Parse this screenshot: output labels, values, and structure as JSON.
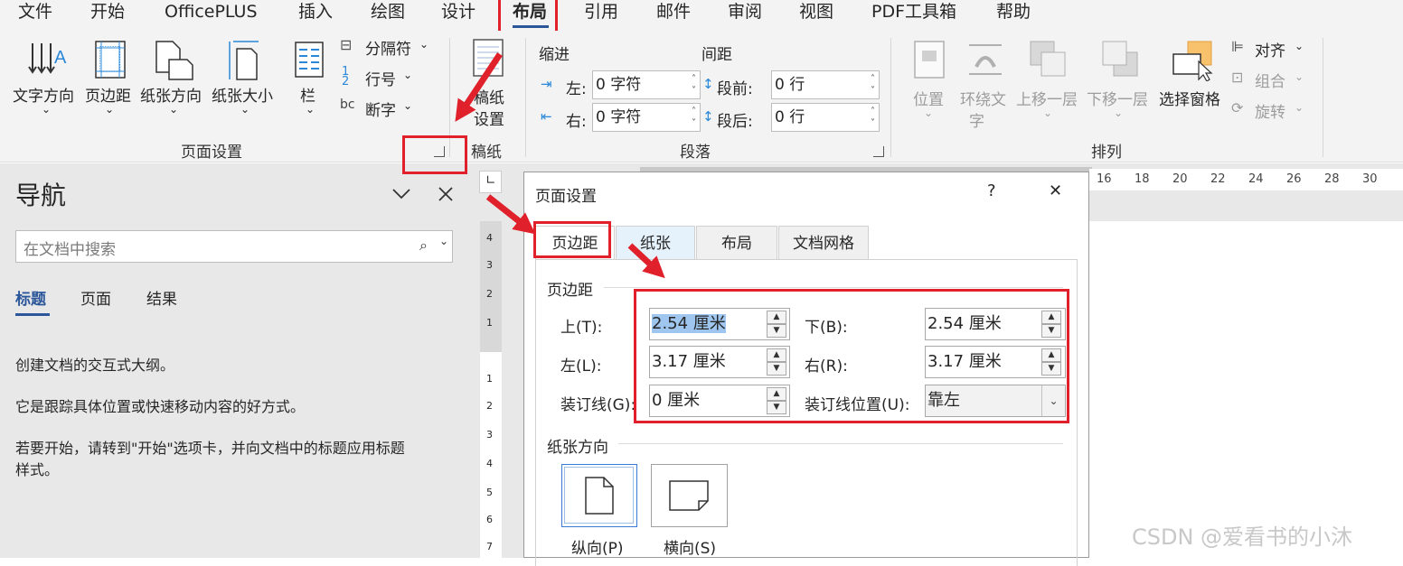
{
  "menubar": {
    "items": [
      "文件",
      "开始",
      "OfficePLUS",
      "插入",
      "绘图",
      "设计",
      "布局",
      "引用",
      "邮件",
      "审阅",
      "视图",
      "PDF工具箱",
      "帮助"
    ],
    "active": "布局"
  },
  "ribbon": {
    "page_setup": {
      "text_direction": "文字方向",
      "margins": "页边距",
      "orientation": "纸张方向",
      "size": "纸张大小",
      "columns": "栏",
      "breaks": "分隔符",
      "line_numbers": "行号",
      "hyphenation": "断字",
      "group_label": "页面设置"
    },
    "manuscript": {
      "label_line1": "稿纸",
      "label_line2": "设置",
      "group_label": "稿纸"
    },
    "paragraph": {
      "indent_header": "缩进",
      "spacing_header": "间距",
      "left_label": "左:",
      "left_value": "0 字符",
      "right_label": "右:",
      "right_value": "0 字符",
      "before_label": "段前:",
      "before_value": "0 行",
      "after_label": "段后:",
      "after_value": "0 行",
      "group_label": "段落"
    },
    "arrange": {
      "position": "位置",
      "wrap_line1": "环绕文",
      "wrap_line2": "字",
      "bring_forward": "上移一层",
      "send_backward": "下移一层",
      "selection_pane": "选择窗格",
      "align": "对齐",
      "group": "组合",
      "rotate": "旋转",
      "group_label": "排列"
    }
  },
  "nav": {
    "title": "导航",
    "search_placeholder": "在文档中搜索",
    "tabs": [
      "标题",
      "页面",
      "结果"
    ],
    "para1": "创建文档的交互式大纲。",
    "para2": "它是跟踪具体位置或快速移动内容的好方式。",
    "para3_line1": "若要开始，请转到\"开始\"选项卡，并向文档中的标题应用标题",
    "para3_line2": "样式。"
  },
  "ruler": {
    "h_ticks": [
      "16",
      "18",
      "20",
      "22",
      "24",
      "26",
      "28",
      "30"
    ],
    "v_ticks": [
      "4",
      "3",
      "2",
      "1",
      "1",
      "1",
      "2",
      "3",
      "4",
      "5",
      "6",
      "7"
    ]
  },
  "dialog": {
    "title": "页面设置",
    "help": "?",
    "close": "✕",
    "tabs": [
      "页边距",
      "纸张",
      "布局",
      "文档网格"
    ],
    "section_margins": "页边距",
    "top_label": "上(T):",
    "top_value": "2.54 厘米",
    "bottom_label": "下(B):",
    "bottom_value": "2.54 厘米",
    "left_label": "左(L):",
    "left_value": "3.17 厘米",
    "right_label": "右(R):",
    "right_value": "3.17 厘米",
    "gutter_label": "装订线(G):",
    "gutter_value": "0 厘米",
    "gutter_pos_label": "装订线位置(U):",
    "gutter_pos_value": "靠左",
    "section_orientation": "纸张方向",
    "portrait": "纵向(P)",
    "landscape": "横向(S)"
  },
  "watermark": "CSDN @爱看书的小沐",
  "colors": {
    "accent": "#2b579a",
    "annotation_red": "#e0202a"
  }
}
